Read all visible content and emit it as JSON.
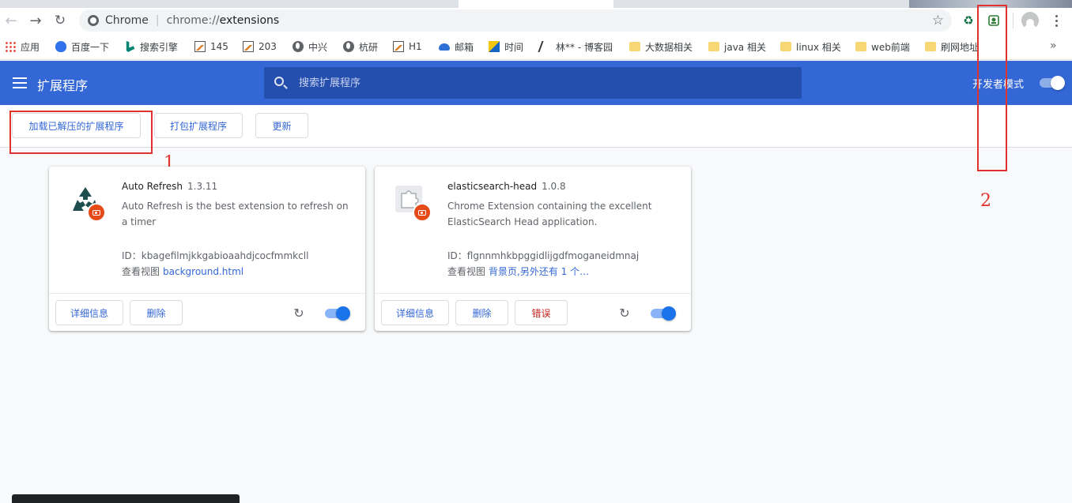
{
  "browser": {
    "omnibox": {
      "scheme_label": "Chrome",
      "url_prefix": "chrome://",
      "url_rest": "extensions"
    },
    "bookmarks": [
      {
        "label": "应用",
        "icon": "apps-icon"
      },
      {
        "label": "百度一下",
        "icon": "paw-icon"
      },
      {
        "label": "搜索引擎",
        "icon": "bing-icon"
      },
      {
        "label": "145",
        "icon": "image-icon"
      },
      {
        "label": "203",
        "icon": "image-icon"
      },
      {
        "label": "中兴",
        "icon": "globe-icon"
      },
      {
        "label": "杭研",
        "icon": "globe-icon"
      },
      {
        "label": "H1",
        "icon": "image-icon"
      },
      {
        "label": "邮箱",
        "icon": "cloud-icon"
      },
      {
        "label": "时间",
        "icon": "clock-icon"
      },
      {
        "label": "林** - 博客园",
        "icon": "feather-icon"
      },
      {
        "label": "大数据相关",
        "icon": "folder-icon"
      },
      {
        "label": "java 相关",
        "icon": "folder-icon"
      },
      {
        "label": "linux 相关",
        "icon": "folder-icon"
      },
      {
        "label": "web前端",
        "icon": "folder-icon"
      },
      {
        "label": "刷网地址",
        "icon": "folder-icon"
      }
    ],
    "more_bookmarks": "»"
  },
  "header": {
    "title": "扩展程序",
    "search_placeholder": "搜索扩展程序",
    "dev_mode_label": "开发者模式",
    "dev_mode_on": true,
    "accent": "#3367d6"
  },
  "actions": {
    "load_unpacked": "加载已解压的扩展程序",
    "pack": "打包扩展程序",
    "update": "更新"
  },
  "annotations": {
    "one": "1",
    "two": "2",
    "color": "#e0322f"
  },
  "extensions": [
    {
      "name": "Auto Refresh",
      "version": "1.3.11",
      "description": "Auto Refresh is the best extension to refresh on a timer",
      "id_line": "ID：kbagefilmjkkgabioaahdjcocfmmkcll",
      "view_label": "查看视图",
      "view_link": "background.html",
      "details": "详细信息",
      "remove": "删除",
      "enabled": true
    },
    {
      "name": "elasticsearch-head",
      "version": "1.0.8",
      "description": "Chrome Extension containing the excellent ElasticSearch Head application.",
      "id_line": "ID：flgnnmhkbpggidlijgdfmoganeidmnaj",
      "view_label": "查看视图",
      "view_link": "背景页,另外还有 1 个…",
      "details": "详细信息",
      "remove": "删除",
      "errors": "错误",
      "enabled": true
    }
  ]
}
